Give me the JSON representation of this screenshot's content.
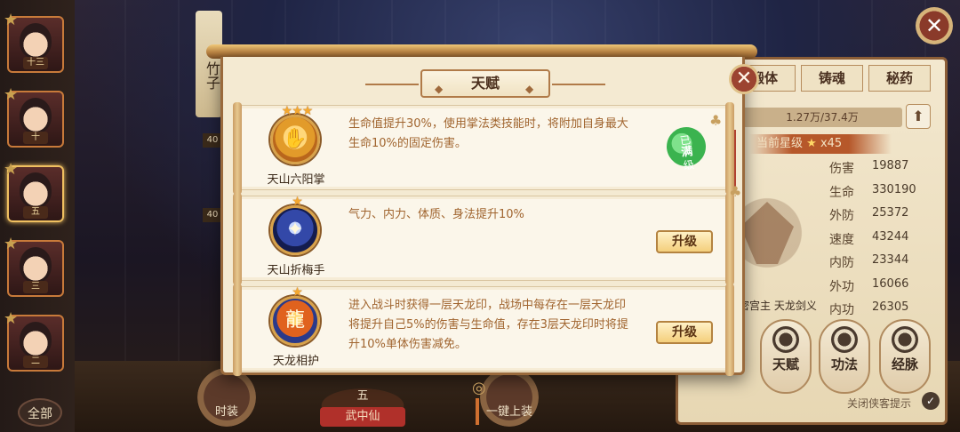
{
  "background": {
    "heroes": [
      {
        "tag": "十三",
        "selected": false
      },
      {
        "tag": "十",
        "selected": false
      },
      {
        "tag": "五",
        "selected": true
      },
      {
        "tag": "三",
        "selected": false
      },
      {
        "tag": "二",
        "selected": false
      }
    ],
    "all_label": "全部",
    "bamboo_name": "竹子",
    "level_badges": [
      "40",
      "40"
    ],
    "bottom_buttons": [
      "时装",
      "一键上装"
    ],
    "center_num": "五",
    "center_label": "武中仙"
  },
  "right_panel": {
    "tabs": [
      "锻体",
      "铸魂",
      "秘药"
    ],
    "hp_text": "1.27万/37.4万",
    "star_label": "当前星级",
    "star_count": "x45",
    "stats": [
      {
        "k": "伤害",
        "v": "19887"
      },
      {
        "k": "生命",
        "v": "330190"
      },
      {
        "k": "外防",
        "v": "25372"
      },
      {
        "k": "速度",
        "v": "43244"
      },
      {
        "k": "内防",
        "v": "23344"
      },
      {
        "k": "外功",
        "v": "16066"
      },
      {
        "k": "内功",
        "v": "26305"
      }
    ],
    "buttons": [
      "天赋",
      "功法",
      "经脉"
    ],
    "sect_text": "密宫主  天龙剑义",
    "close_hint": "关闭侠客提示"
  },
  "modal": {
    "title": "天赋",
    "talents": [
      {
        "name": "天山六阳掌",
        "stars": "★★★",
        "desc": "生命值提升30%，使用掌法类技能时，将附加自身最大生命10%的固定伤害。",
        "status": "maxed",
        "maxed_label_top": "已",
        "maxed_label_main": "满",
        "maxed_label_bottom": "级"
      },
      {
        "name": "天山折梅手",
        "stars": "★",
        "desc": "气力、内力、体质、身法提升10%",
        "status": "upgrade",
        "button": "升级"
      },
      {
        "name": "天龙相护",
        "stars": "★",
        "desc": "进入战斗时获得一层天龙印，战场中每存在一层天龙印将提升自己5%的伤害与生命值，存在3层天龙印时将提升10%单体伤害减免。",
        "status": "upgrade",
        "button": "升级"
      }
    ]
  },
  "colors": {
    "desc_text": "#a0642e",
    "panel_bg": "#f4ead2",
    "maxed_green": "#3bb34f"
  }
}
